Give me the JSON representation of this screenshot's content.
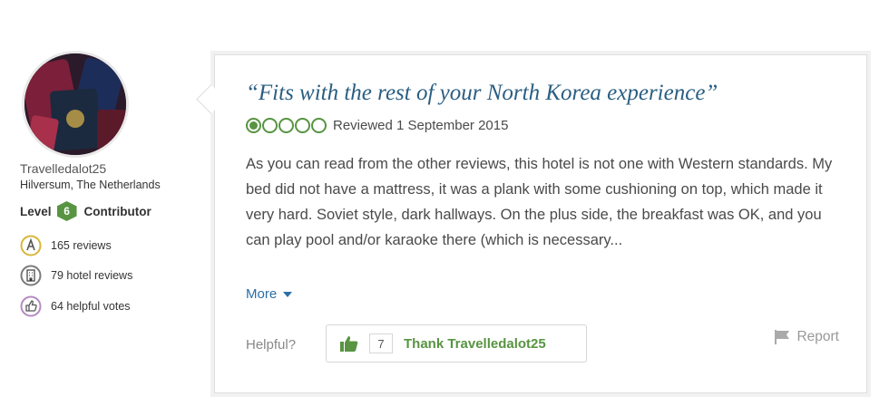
{
  "reviewer": {
    "username": "Travelledalot25",
    "location": "Hilversum, The Netherlands",
    "level_prefix": "Level",
    "level": "6",
    "level_suffix": "Contributor",
    "stats": {
      "reviews": "165 reviews",
      "hotel_reviews": "79 hotel reviews",
      "helpful_votes": "64 helpful votes"
    }
  },
  "review": {
    "title": "“Fits with the rest of your North Korea experience”",
    "rating": 1,
    "rating_max": 5,
    "date": "Reviewed 1 September 2015",
    "body": "As you can read from the other reviews, this hotel is not one with Western standards. My bed did not have a mattress, it was a plank with some cushioning on top, which made it very hard. Soviet style, dark hallways. On the plus side, the breakfast was OK, and you can play pool and/or karaoke there (which is necessary...",
    "more_label": "More",
    "helpful_label": "Helpful?",
    "thank_count": "7",
    "thank_label": "Thank Travelledalot25",
    "report_label": "Report"
  },
  "colors": {
    "brand_green": "#589442",
    "title_blue": "#2a5e82",
    "link_blue": "#2a6ea8",
    "reviews_ring": "#d8b63a",
    "hotel_ring": "#7a7a7a",
    "votes_ring": "#b58ac2"
  },
  "icons": {
    "avatar": "passports-photo",
    "reviews": "reviews-badge-icon",
    "hotel_reviews": "hotel-building-icon",
    "helpful_votes": "thumbs-up-badge-icon",
    "thank": "thumbs-up-icon",
    "report": "flag-icon",
    "more": "caret-down-icon"
  }
}
